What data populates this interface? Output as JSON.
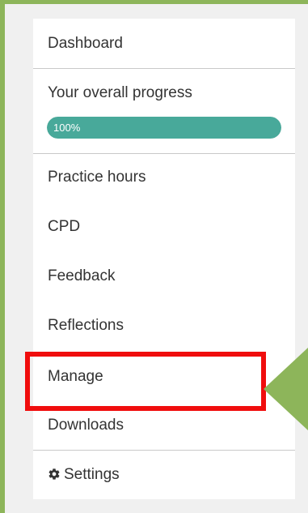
{
  "menu": {
    "dashboard": "Dashboard",
    "progress_label": "Your overall progress",
    "progress_text": "100%",
    "progress_value": 100,
    "practice_hours": "Practice hours",
    "cpd": "CPD",
    "feedback": "Feedback",
    "reflections": "Reflections",
    "manage": "Manage",
    "downloads": "Downloads",
    "settings": "Settings"
  },
  "colors": {
    "frame_border": "#8db55a",
    "progress_fill": "#48a99a",
    "highlight": "#f00d0d",
    "arrow": "#8db55a"
  },
  "icons": {
    "settings": "gear-icon"
  }
}
